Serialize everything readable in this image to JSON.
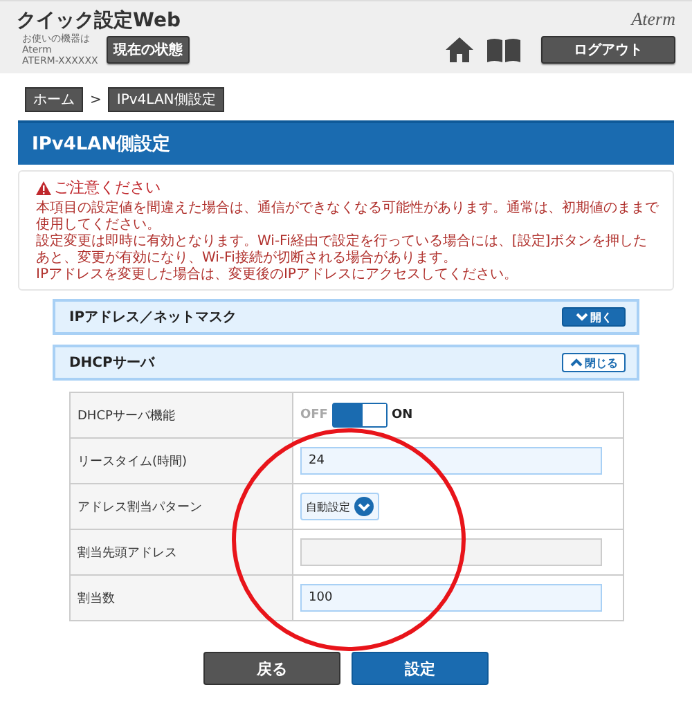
{
  "header": {
    "title": "クイック設定Web",
    "device_lines": [
      "お使いの機器は",
      "Aterm",
      "ATERM-XXXXXX"
    ],
    "status_button": "現在の状態",
    "brand": "Aterm",
    "logout_button": "ログアウト"
  },
  "breadcrumb": [
    {
      "label": "ホーム"
    },
    {
      "label": "IPv4LAN側設定"
    }
  ],
  "breadcrumb_separator": ">",
  "page_title": "IPv4LAN側設定",
  "notice": {
    "title": "ご注意ください",
    "paragraphs": [
      "本項目の設定値を間違えた場合は、通信ができなくなる可能性があります。通常は、初期値のままで使用してください。",
      "設定変更は即時に有効となります。Wi-Fi経由で設定を行っている場合には、[設定]ボタンを押したあと、変更が有効になり、Wi-Fi接続が切断される場合があります。",
      "IPアドレスを変更した場合は、変更後のIPアドレスにアクセスしてください。"
    ]
  },
  "sections": [
    {
      "title": "IPアドレス／ネットマスク",
      "expanded": false,
      "toggle_label": "開く"
    },
    {
      "title": "DHCPサーバ",
      "expanded": true,
      "toggle_label": "閉じる"
    }
  ],
  "rows": [
    {
      "kind": "toggle",
      "label": "DHCPサーバ機能",
      "off_label": "OFF",
      "on_label": "ON",
      "on": true
    },
    {
      "kind": "text",
      "label": "リースタイム(時間)",
      "value": "24",
      "disabled": false
    },
    {
      "kind": "select",
      "label": "アドレス割当パターン",
      "value": "自動設定"
    },
    {
      "kind": "text",
      "label": "割当先頭アドレス",
      "disabled": true
    },
    {
      "kind": "text",
      "label": "割当数",
      "value": "100",
      "disabled": false
    }
  ],
  "buttons": [
    {
      "label": "戻る",
      "kind": "secondary"
    },
    {
      "label": "設定",
      "kind": "primary"
    }
  ]
}
